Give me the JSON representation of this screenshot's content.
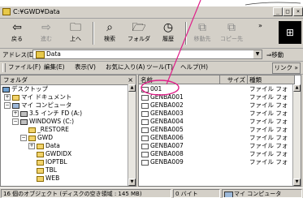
{
  "window": {
    "title": "C:¥GWD¥Data",
    "minimize": "_",
    "maximize": "□",
    "close": "×"
  },
  "toolbar": {
    "buttons": [
      {
        "label": "戻る",
        "icon": "back-arrow"
      },
      {
        "label": "進む",
        "icon": "forward-arrow"
      },
      {
        "label": "上へ",
        "icon": "up-folder"
      },
      {
        "label": "検索",
        "icon": "search"
      },
      {
        "label": "フォルダ",
        "icon": "folders"
      },
      {
        "label": "履歴",
        "icon": "history"
      },
      {
        "label": "移動先",
        "icon": "move-to"
      },
      {
        "label": "コピー先",
        "icon": "copy-to"
      }
    ],
    "more": "»"
  },
  "address": {
    "label": "アドレス(D)",
    "value": "Data",
    "go": "移動"
  },
  "menu": {
    "items": [
      "ファイル(F)",
      "編集(E)",
      "表示(V)",
      "お気に入り(A)",
      "ツール(T)",
      "ヘルプ(H)"
    ],
    "links": "リンク »"
  },
  "folders_pane": {
    "header": "フォルダ",
    "close": "×",
    "tree": [
      {
        "label": "デスクトップ",
        "icon": "desktop",
        "indent": 0
      },
      {
        "label": "マイ ドキュメント",
        "icon": "folder",
        "indent": 1
      },
      {
        "label": "マイ コンピュータ",
        "icon": "computer",
        "indent": 1
      },
      {
        "label": "3.5 インチ FD (A:)",
        "icon": "drive",
        "indent": 2
      },
      {
        "label": "WINDOWS (C:)",
        "icon": "drive",
        "indent": 2
      },
      {
        "label": "_RESTORE",
        "icon": "folder",
        "indent": 3
      },
      {
        "label": "GWD",
        "icon": "folder",
        "indent": 3
      },
      {
        "label": "Data",
        "icon": "folder",
        "indent": 4
      },
      {
        "label": "GWDIDX",
        "icon": "folder",
        "indent": 4
      },
      {
        "label": "IOPTBL",
        "icon": "folder",
        "indent": 4
      },
      {
        "label": "TBL",
        "icon": "folder",
        "indent": 4
      },
      {
        "label": "WEB",
        "icon": "folder",
        "indent": 4
      }
    ]
  },
  "files_pane": {
    "columns": {
      "name": "名前",
      "size": "サイズ",
      "type": "種類"
    },
    "rows": [
      {
        "name": "001",
        "type": "ファイル フォ"
      },
      {
        "name": "GENBA001",
        "type": "ファイル フォ"
      },
      {
        "name": "GENBA002",
        "type": "ファイル フォ"
      },
      {
        "name": "GENBA003",
        "type": "ファイル フォ"
      },
      {
        "name": "GENBA004",
        "type": "ファイル フォ"
      },
      {
        "name": "GENBA005",
        "type": "ファイル フォ"
      },
      {
        "name": "GENBA006",
        "type": "ファイル フォ"
      },
      {
        "name": "GENBA007",
        "type": "ファイル フォ"
      },
      {
        "name": "GENBA008",
        "type": "ファイル フォ"
      },
      {
        "name": "GENBA009",
        "type": "ファイル フォ"
      }
    ]
  },
  "status": {
    "objects": "16 個のオブジェクト (ディスクの空き領域 : 145 MB)",
    "size": "0 バイト",
    "location": "マイ コンピュータ"
  },
  "colors": {
    "annotation": "#e0208a",
    "folder": "#f2d36b"
  }
}
